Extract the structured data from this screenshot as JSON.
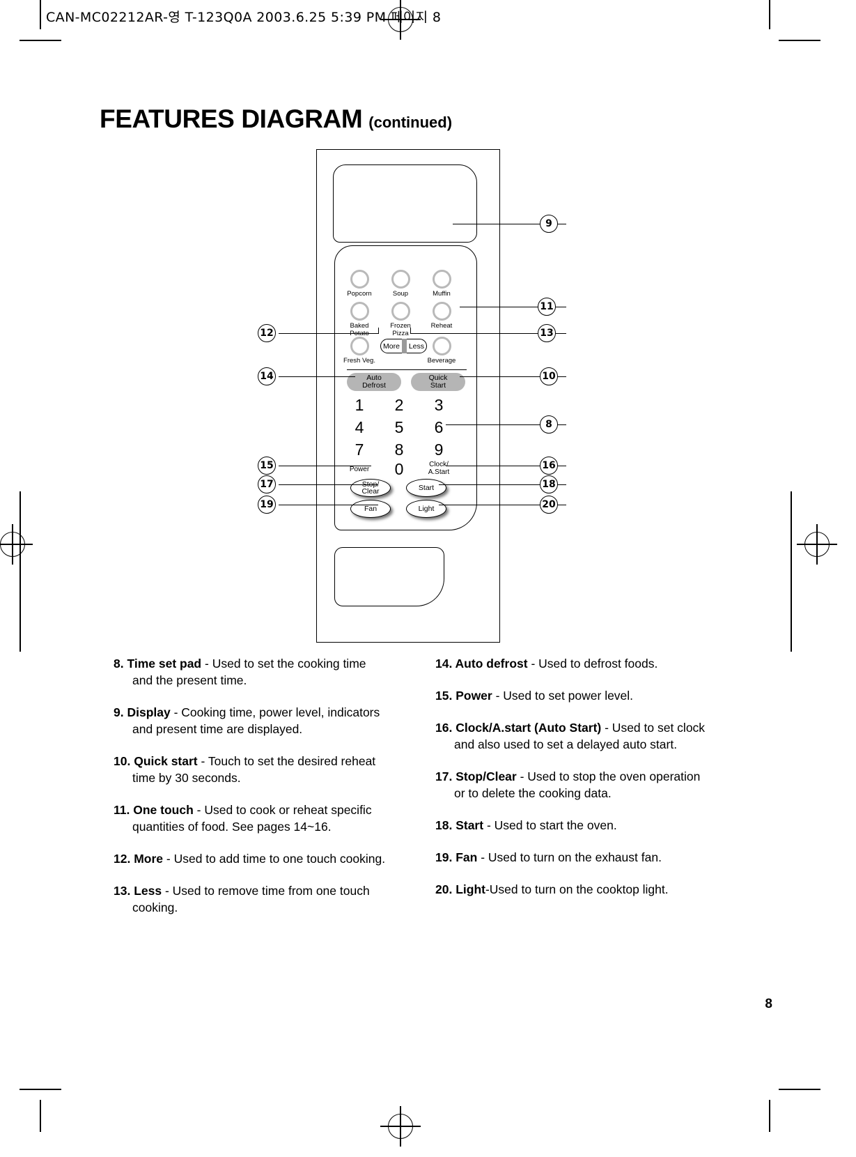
{
  "running_header": "CAN-MC02212AR-영 T-123Q0A  2003.6.25 5:39 PM 페이지 8",
  "title": {
    "main": "FEATURES DIAGRAM",
    "continued": "(continued)"
  },
  "page_number": "8",
  "panel": {
    "one_touch_pads": [
      {
        "label": "Popcorn"
      },
      {
        "label": "Soup"
      },
      {
        "label": "Muffin"
      },
      {
        "label": "Baked\nPotato"
      },
      {
        "label": "Frozen\nPizza"
      },
      {
        "label": "Reheat"
      },
      {
        "label": "Fresh Veg."
      },
      {
        "label": "Beverage"
      }
    ],
    "more_label": "More",
    "less_label": "Less",
    "capsules": [
      {
        "label": "Auto\nDefrost"
      },
      {
        "label": "Quick\nStart"
      }
    ],
    "keypad": [
      "1",
      "2",
      "3",
      "4",
      "5",
      "6",
      "7",
      "8",
      "9"
    ],
    "zero": "0",
    "power_label": "Power",
    "clock_label": "Clock/\nA.Start",
    "ovals": [
      {
        "label": "Stop/\nClear"
      },
      {
        "label": "Start"
      },
      {
        "label": "Fan"
      },
      {
        "label": "Light"
      }
    ]
  },
  "callouts": {
    "c8": "8",
    "c9": "9",
    "c10": "10",
    "c11": "11",
    "c12": "12",
    "c13": "13",
    "c14": "14",
    "c15": "15",
    "c16": "16",
    "c17": "17",
    "c18": "18",
    "c19": "19",
    "c20": "20"
  },
  "descriptions": {
    "left": [
      {
        "num": "8.",
        "term": "Time set pad",
        "text": " - Used to set the cooking time and the present time."
      },
      {
        "num": "9.",
        "term": "Display",
        "text": " - Cooking time, power level, indicators and present time are displayed."
      },
      {
        "num": "10.",
        "term": "Quick start",
        "text": " - Touch to set the desired reheat time by 30 seconds."
      },
      {
        "num": "11.",
        "term": "One touch",
        "text": " - Used to cook or reheat specific quantities of food. See pages 14~16."
      },
      {
        "num": "12.",
        "term": "More",
        "text": " - Used to add time to one touch cooking."
      },
      {
        "num": "13.",
        "term": "Less",
        "text": " - Used to remove time from one touch cooking."
      }
    ],
    "right": [
      {
        "num": "14.",
        "term": "Auto defrost",
        "text": " - Used to defrost foods."
      },
      {
        "num": "15.",
        "term": "Power",
        "text": " - Used to set power level."
      },
      {
        "num": "16.",
        "term": "Clock/A.start (Auto Start)",
        "text": " - Used to set clock and also used to set a delayed auto start."
      },
      {
        "num": "17.",
        "term": "Stop/Clear",
        "text": " - Used to stop the oven operation or to delete the cooking data."
      },
      {
        "num": "18.",
        "term": "Start",
        "text": " - Used to start the oven."
      },
      {
        "num": "19.",
        "term": "Fan",
        "text": " - Used to turn on the exhaust fan."
      },
      {
        "num": "20.",
        "term": "Light",
        "text": "-Used to turn on the cooktop light."
      }
    ]
  }
}
